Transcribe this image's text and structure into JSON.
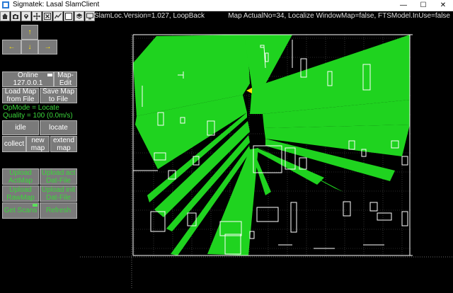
{
  "window": {
    "title": "Sigmatek: Lasal SlamClient",
    "controls": {
      "minimize": "—",
      "maximize": "☐",
      "close": "✕"
    }
  },
  "toolbar": {
    "icons": [
      "home-icon",
      "camera-icon",
      "location-pin-icon",
      "move-crosshair-icon",
      "close-box-icon",
      "graph-icon",
      "checkbox-icon",
      "layers-icon",
      "monitor-icon"
    ],
    "status_left": "SlamLoc.Version=1.027, LoopBack",
    "status_right": "Map ActualNo=34, Localize WindowMap=false, FTSModel.InUse=false"
  },
  "arrows": {
    "up": "↑",
    "left": "←",
    "down": "↓",
    "right": "→"
  },
  "panel": {
    "online_line1": "Online",
    "online_line2": "127.0.0.1",
    "map_edit_line1": "Map-",
    "map_edit_line2": "Edit",
    "load_map_line1": "Load Map",
    "load_map_line2": "from File",
    "save_map_line1": "Save Map",
    "save_map_line2": "to File",
    "opmode": "OpMode = Locate",
    "quality": "Quality = 100 (0.0m/s)",
    "idle": "idle",
    "locate": "locate",
    "collect": "collect",
    "new_map_line1": "new",
    "new_map_line2": "map",
    "extend_map_line1": "extend",
    "extend_map_line2": "map",
    "upload_actmap_line1": "Upload",
    "upload_actmap_line2": "ActMap",
    "upload_actdat_line1": "Upload act",
    "upload_actdat_line2": "Dat-File",
    "upload_rawmap_line1": "Upload",
    "upload_rawmap_line2": "RawMap",
    "upload_initdat_line1": "Upload init",
    "upload_initdat_line2": "Dat-File",
    "get_scans": "Get Scans",
    "refresh": "Refresh"
  },
  "colors": {
    "scan": "#1fd31f",
    "grid": "#555555",
    "wall": "#ffffff",
    "robot": "#ffe600",
    "button_text_green": "#3bd63b"
  }
}
